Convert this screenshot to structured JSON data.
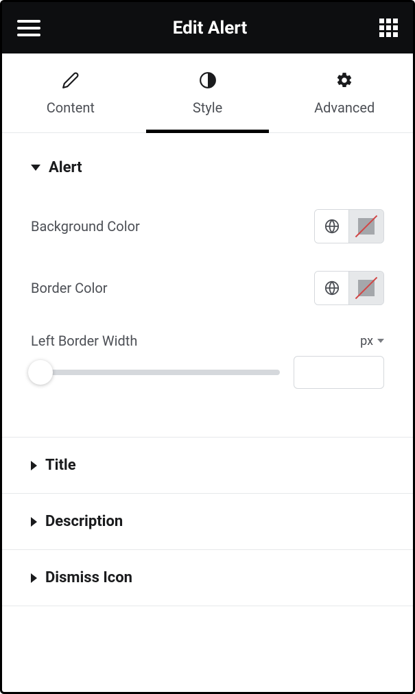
{
  "header": {
    "title": "Edit Alert"
  },
  "tabs": {
    "content": {
      "label": "Content"
    },
    "style": {
      "label": "Style"
    },
    "advanced": {
      "label": "Advanced"
    }
  },
  "sections": {
    "alert": {
      "title": "Alert",
      "background_color": {
        "label": "Background Color"
      },
      "border_color": {
        "label": "Border Color"
      },
      "left_border_width": {
        "label": "Left Border Width",
        "unit": "px",
        "value": ""
      }
    },
    "title": {
      "title": "Title"
    },
    "description": {
      "title": "Description"
    },
    "dismiss_icon": {
      "title": "Dismiss Icon"
    }
  }
}
